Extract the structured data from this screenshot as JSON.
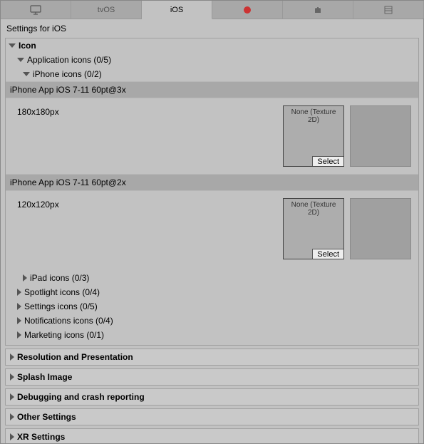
{
  "tabs": {
    "standalone": "",
    "tvos": "tvOS",
    "ios": "iOS",
    "switch": "",
    "android": "",
    "webgl": ""
  },
  "header": "Settings for iOS",
  "icon": {
    "title": "Icon",
    "app_icons": "Application icons (0/5)",
    "iphone_icons": "iPhone icons (0/2)",
    "slots": [
      {
        "title": "iPhone App iOS 7-11 60pt@3x",
        "size": "180x180px",
        "picker_caption": "None (Texture 2D)",
        "select": "Select"
      },
      {
        "title": "iPhone App iOS 7-11 60pt@2x",
        "size": "120x120px",
        "picker_caption": "None (Texture 2D)",
        "select": "Select"
      }
    ],
    "subs": {
      "ipad": "iPad icons (0/3)",
      "spotlight": "Spotlight icons (0/4)",
      "settings": "Settings icons (0/5)",
      "notifications": "Notifications icons (0/4)",
      "marketing": "Marketing icons (0/1)"
    }
  },
  "sections": {
    "resolution": "Resolution and Presentation",
    "splash": "Splash Image",
    "debug": "Debugging and crash reporting",
    "other": "Other Settings",
    "xr": "XR Settings"
  }
}
